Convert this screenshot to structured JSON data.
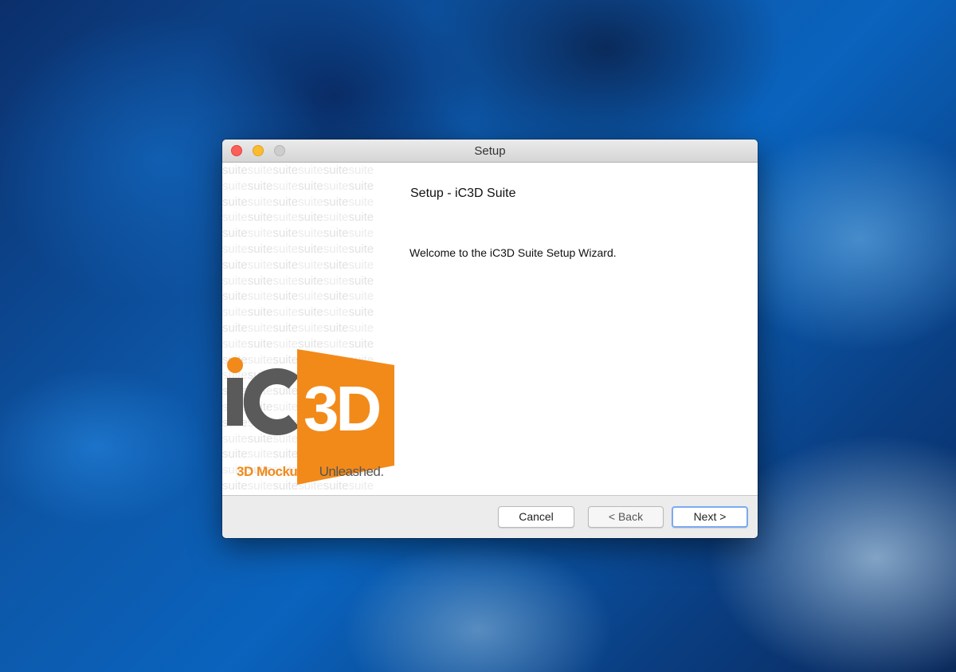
{
  "window": {
    "title": "Setup",
    "controls": [
      "close-button",
      "minimize-button",
      "zoom-button"
    ]
  },
  "sidebar": {
    "pattern_word": "suite",
    "logo": {
      "text_dark": "iC",
      "text_light": "3D",
      "tagline_bold": "3D Mockups.",
      "tagline_regular": "Unleashed."
    }
  },
  "main": {
    "heading": "Setup - iC3D Suite",
    "welcome": "Welcome to the iC3D Suite Setup Wizard."
  },
  "buttons": {
    "cancel": "Cancel",
    "back": "< Back",
    "next": "Next >"
  },
  "colors": {
    "brand_orange": "#f28a1a",
    "brand_gray": "#5a5a5a",
    "default_button_ring": "#7aaaf2"
  }
}
